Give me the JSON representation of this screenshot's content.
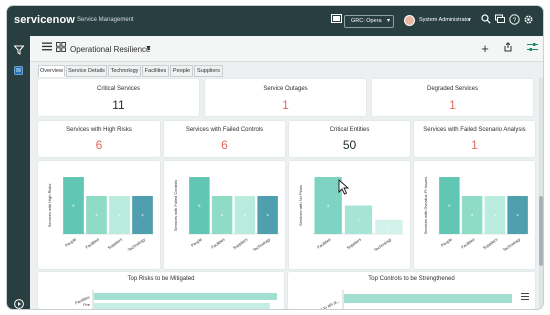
{
  "header": {
    "logo": "servicenow",
    "subtitle": "Service Management",
    "scope": "GRC: Opera",
    "user": "System Administrator"
  },
  "workspace": {
    "title": "Operational Resilience"
  },
  "tabs": [
    "Overview",
    "Service Details",
    "Technology",
    "Facilities",
    "People",
    "Suppliers"
  ],
  "summary": {
    "critical_services": {
      "label": "Critical Services",
      "value": "11"
    },
    "service_outages": {
      "label": "Service Outages",
      "value": "1"
    },
    "degraded_services": {
      "label": "Degraded Services",
      "value": "1"
    }
  },
  "metrics": {
    "high_risks": {
      "label": "Services with High Risks",
      "value": "6"
    },
    "failed_controls": {
      "label": "Services with Failed Controls",
      "value": "6"
    },
    "critical_entities": {
      "label": "Critical Entities",
      "value": "50"
    },
    "failed_scenario": {
      "label": "Services with Failed Scenario Analysis",
      "value": "1"
    }
  },
  "chart_data": [
    {
      "type": "bar",
      "ylabel": "Services with High Risks",
      "categories": [
        "People",
        "Facilities",
        "Suppliers",
        "Technology"
      ],
      "values": [
        6,
        4,
        4,
        4
      ],
      "colors": [
        "#62c6b4",
        "#8fdcc6",
        "#b9ecdc",
        "#4f9fae"
      ]
    },
    {
      "type": "bar",
      "ylabel": "Services with Failed Controls",
      "categories": [
        "People",
        "Facilities",
        "Suppliers",
        "Technology"
      ],
      "values": [
        6,
        4,
        4,
        4
      ],
      "colors": [
        "#62c6b4",
        "#8fdcc6",
        "#b9ecdc",
        "#4f9fae"
      ]
    },
    {
      "type": "bar",
      "ylabel": "Services with No Plans",
      "categories": [
        "Facilities",
        "Suppliers",
        "Technology"
      ],
      "values": [
        4,
        2,
        1
      ],
      "colors": [
        "#7fd3c2",
        "#a6e4d5",
        "#d3f2ea"
      ]
    },
    {
      "type": "bar",
      "ylabel": "Services with Overdue PI Issues",
      "categories": [
        "People",
        "Facilities",
        "Suppliers",
        "Technology"
      ],
      "values": [
        6,
        4,
        4,
        4
      ],
      "colors": [
        "#62c6b4",
        "#8fdcc6",
        "#b9ecdc",
        "#4f9fae"
      ]
    }
  ],
  "panels": {
    "top_risks": {
      "title": "Top Risks to be Mitigated",
      "labels": [
        "Facilities",
        "Fire"
      ]
    },
    "top_controls": {
      "title": "Top Controls to be Strengthened",
      "labels": [
        "Access to ath di..."
      ]
    }
  }
}
